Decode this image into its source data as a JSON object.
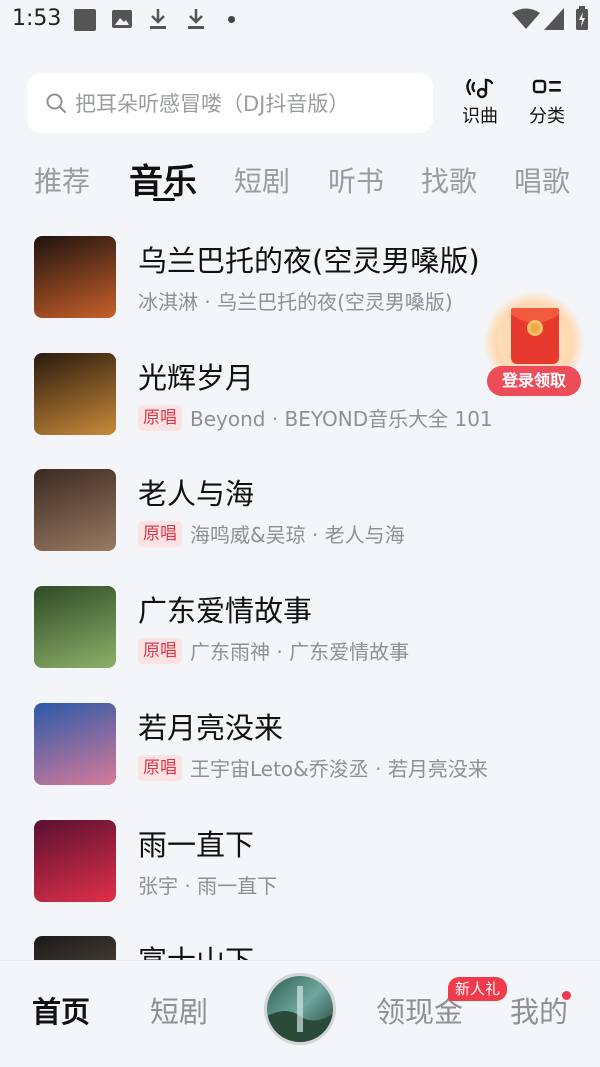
{
  "status_bar": {
    "time": "1:53"
  },
  "search": {
    "placeholder": "把耳朵听感冒喽（DJ抖音版）"
  },
  "top_actions": {
    "identify_label": "识曲",
    "category_label": "分类"
  },
  "tabs": [
    {
      "label": "推荐",
      "active": false
    },
    {
      "label": "音乐",
      "active": true
    },
    {
      "label": "短剧",
      "active": false
    },
    {
      "label": "听书",
      "active": false
    },
    {
      "label": "找歌",
      "active": false
    },
    {
      "label": "唱歌",
      "active": false
    }
  ],
  "songs": [
    {
      "title": "乌兰巴托的夜(空灵男嗓版)",
      "original_badge": "",
      "subtitle": "冰淇淋 · 乌兰巴托的夜(空灵男嗓版)",
      "cover_colors": [
        "#1e130f",
        "#c9602a"
      ]
    },
    {
      "title": "光辉岁月",
      "original_badge": "原唱",
      "subtitle": "Beyond · BEYOND音乐大全 101",
      "cover_colors": [
        "#2a1a0e",
        "#c98a3a"
      ]
    },
    {
      "title": "老人与海",
      "original_badge": "原唱",
      "subtitle": "海鸣威&吴琼 · 老人与海",
      "cover_colors": [
        "#3a2a22",
        "#9a7a62"
      ]
    },
    {
      "title": "广东爱情故事",
      "original_badge": "原唱",
      "subtitle": "广东雨神 · 广东爱情故事",
      "cover_colors": [
        "#2f4a26",
        "#8fb06a"
      ]
    },
    {
      "title": "若月亮没来",
      "original_badge": "原唱",
      "subtitle": "王宇宙Leto&乔浚丞 · 若月亮没来",
      "cover_colors": [
        "#2a5aa8",
        "#d87a9a"
      ]
    },
    {
      "title": "雨一直下",
      "original_badge": "",
      "subtitle": "张宇 · 雨一直下",
      "cover_colors": [
        "#5a1030",
        "#e0304a"
      ]
    },
    {
      "title": "富士山下",
      "original_badge": "",
      "subtitle": "",
      "cover_colors": [
        "#1a1a1a",
        "#6a5a4a"
      ]
    }
  ],
  "promo": {
    "label": "登录领取"
  },
  "bottom_nav": {
    "home": "首页",
    "drama": "短剧",
    "cash": "领现金",
    "cash_badge": "新人礼",
    "mine": "我的"
  },
  "colors": {
    "accent_red": "#ef3b4c",
    "badge_bg": "#fbe3e4",
    "muted_text": "#8e9097"
  }
}
